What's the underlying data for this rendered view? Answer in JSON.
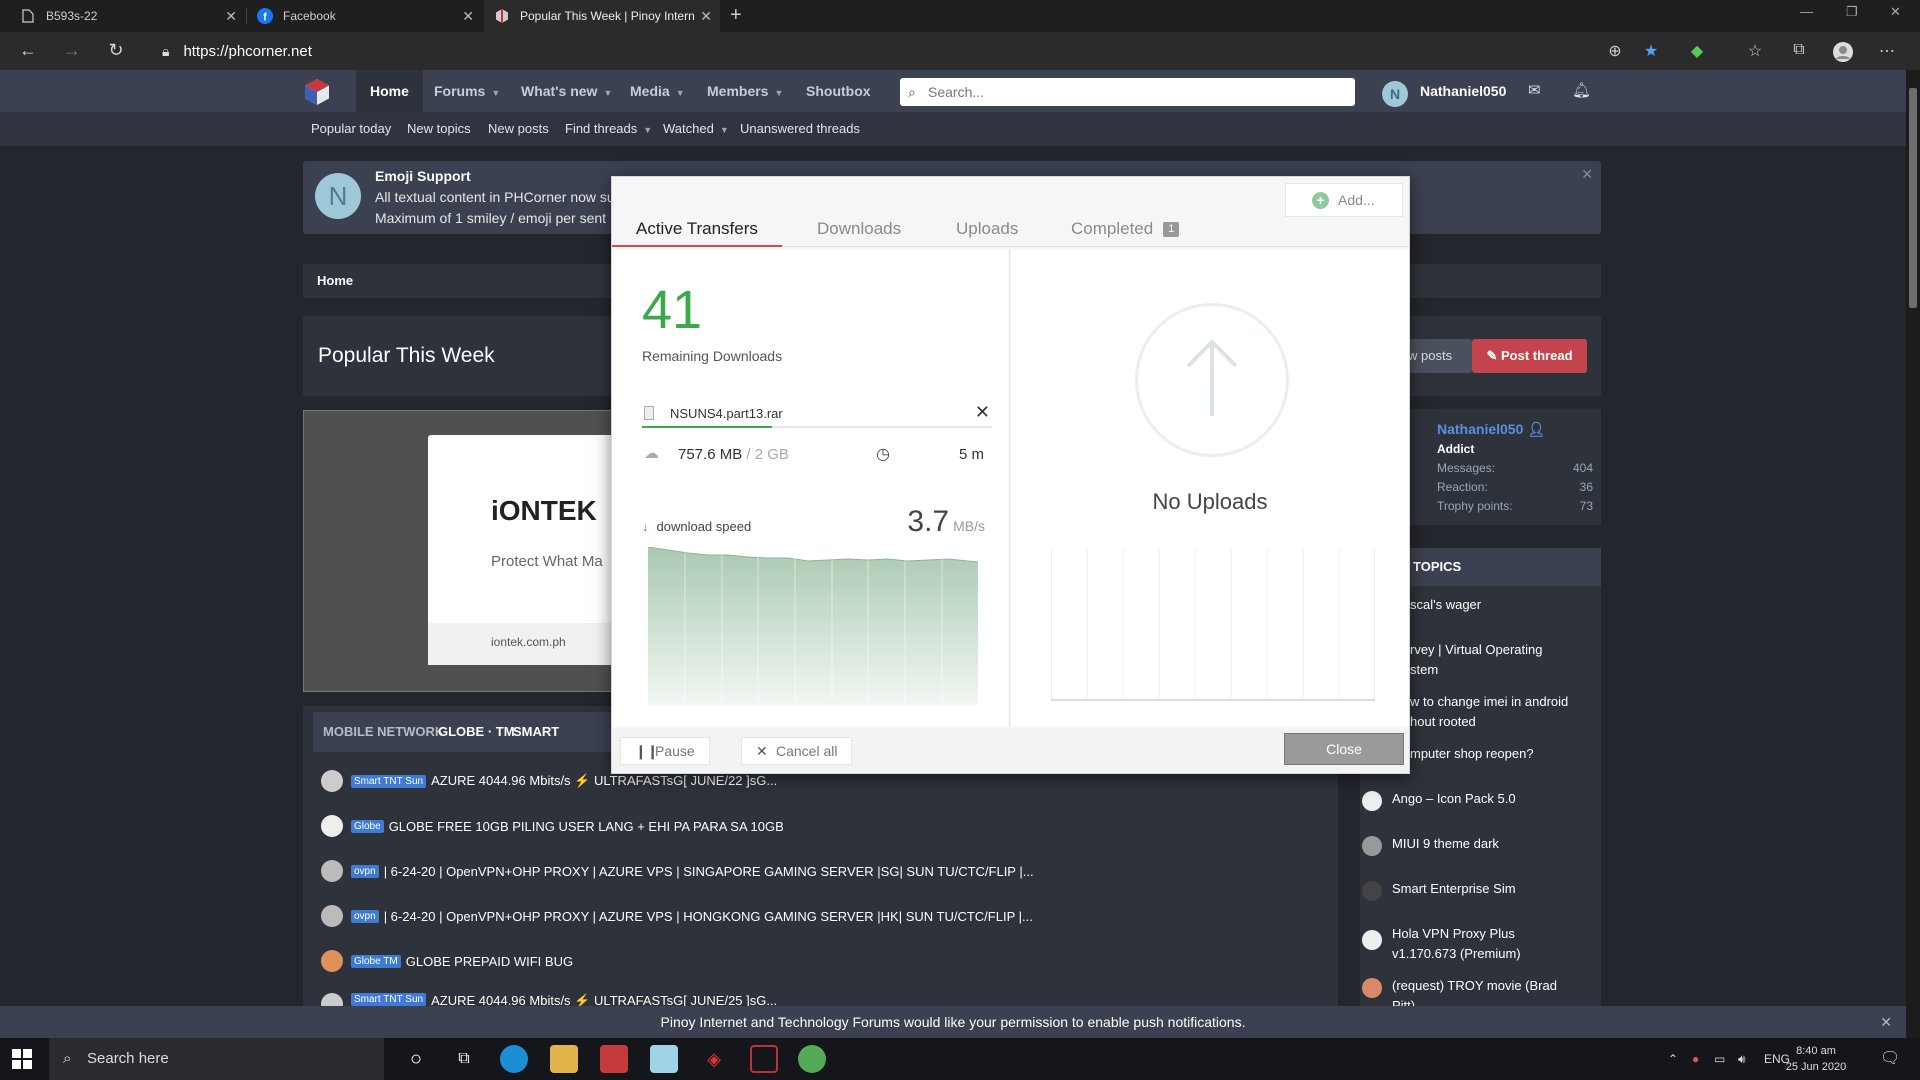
{
  "browser": {
    "tabs": [
      {
        "title": "B593s-22"
      },
      {
        "title": "Facebook"
      },
      {
        "title": "Popular This Week | Pinoy Intern"
      }
    ],
    "url": "https://phcorner.net",
    "new_tab_glyph": "+"
  },
  "site": {
    "nav": [
      {
        "label": "Home",
        "active": true
      },
      {
        "label": "Forums",
        "caret": true
      },
      {
        "label": "What's new",
        "caret": true
      },
      {
        "label": "Media",
        "caret": true
      },
      {
        "label": "Members",
        "caret": true
      },
      {
        "label": "Shoutbox"
      }
    ],
    "search_placeholder": "Search...",
    "user_initial": "N",
    "user_name": "Nathaniel050",
    "subnav": [
      {
        "label": "Popular today"
      },
      {
        "label": "New topics"
      },
      {
        "label": "New posts"
      },
      {
        "label": "Find threads",
        "caret": true
      },
      {
        "label": "Watched",
        "caret": true
      },
      {
        "label": "Unanswered threads"
      }
    ],
    "notice": {
      "avatar_initial": "N",
      "title": "Emoji Support",
      "line1": "All textual content in PHCorner now su",
      "line2": "Maximum of 1 smiley / emoji per sent"
    },
    "breadcrumb": "Home",
    "page_title": "Popular This Week",
    "new_posts_label": "w posts",
    "post_thread_label": "Post thread",
    "ad": {
      "brand": "iONTEK",
      "tagline": "Protect What Ma",
      "url": "iontek.com.ph"
    },
    "feed_tabs": [
      "MOBILE NETWORK",
      "GLOBE · TM",
      "SMART"
    ],
    "feed": [
      {
        "badge": "Smart TNT Sun",
        "text": "AZURE 4044.96 Mbits/s ⚡ ULTRAFASTsG[ JUNE/22 ]sG..."
      },
      {
        "badge": "Globe",
        "text": "GLOBE FREE 10GB PILING USER LANG + EHI PA PARA SA 10GB"
      },
      {
        "badge": "ovpn",
        "text": "| 6-24-20 | OpenVPN+OHP PROXY | AZURE VPS | SINGAPORE GAMING SERVER |SG| SUN TU/CTC/FLIP |..."
      },
      {
        "badge": "ovpn",
        "text": "| 6-24-20 | OpenVPN+OHP PROXY | AZURE VPS | HONGKONG GAMING SERVER |HK| SUN TU/CTC/FLIP |..."
      },
      {
        "badge": "Globe TM",
        "text": "GLOBE PREPAID WIFI BUG"
      },
      {
        "badge": "Smart TNT Sun",
        "text": "AZURE 4044.96 Mbits/s ⚡ ULTRAFASTsG[ JUNE/25 ]sG..."
      }
    ],
    "profile": {
      "name": "Nathaniel050",
      "rank": "Addict",
      "stats": [
        {
          "label": "Messages:",
          "value": "404"
        },
        {
          "label": "Reaction:",
          "value": "36"
        },
        {
          "label": "Trophy points:",
          "value": "73"
        }
      ]
    },
    "topics_title": "TOPICS",
    "topics": [
      {
        "l1": "scal's wager",
        "l2": ""
      },
      {
        "l1": "rvey | Virtual Operating",
        "l2": "stem"
      },
      {
        "l1": "w to change imei in android",
        "l2": "hout rooted"
      },
      {
        "l1": "mputer shop reopen?",
        "l2": ""
      },
      {
        "l1": "Ango – Icon Pack 5.0",
        "l2": ""
      },
      {
        "l1": "MIUI 9 theme dark",
        "l2": ""
      },
      {
        "l1": "Smart Enterprise Sim",
        "l2": ""
      },
      {
        "l1": "Hola VPN Proxy Plus",
        "l2": "v1.170.673 (Premium)"
      },
      {
        "l1": "(request) TROY movie (Brad",
        "l2": "Pitt)"
      }
    ],
    "push_notice": "Pinoy Internet and Technology Forums would like your permission to enable push notifications."
  },
  "download_manager": {
    "add_label": "Add...",
    "tabs": [
      {
        "label": "Active Transfers",
        "active": true
      },
      {
        "label": "Downloads"
      },
      {
        "label": "Uploads"
      },
      {
        "label": "Completed",
        "count": "1"
      }
    ],
    "remaining_count": "41",
    "remaining_label": "Remaining Downloads",
    "file": {
      "name": "NSUNS4.part13.rar",
      "downloaded": "757.6 MB",
      "total": " / 2 GB",
      "eta": "5 m",
      "progress": 0.37
    },
    "speed_label": "download speed",
    "speed_value": "3.7",
    "speed_unit": "MB/s",
    "no_uploads_label": "No Uploads",
    "pause_label": "Pause",
    "cancel_all_label": "Cancel all",
    "close_label": "Close",
    "accent_color": "#3da84a"
  },
  "taskbar": {
    "search_placeholder": "Search here",
    "lang": "ENG",
    "time": "8:40 am",
    "date": "25 Jun 2020"
  }
}
